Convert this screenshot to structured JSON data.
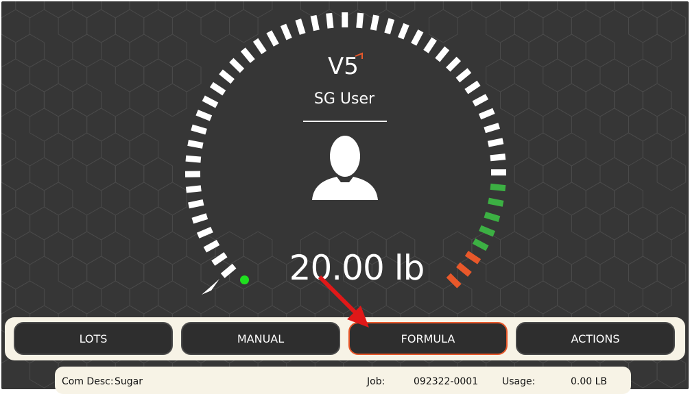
{
  "header": {
    "logo_text": "V5",
    "user_name": "SG User",
    "user_icon": "user-silhouette-icon"
  },
  "scale": {
    "weight_display": "20.00 lb",
    "status_dot_color": "#1fe01f",
    "segment_colors": {
      "normal": "#ffffff",
      "target": "#3cb043",
      "over": "#e8582a"
    }
  },
  "buttons": [
    {
      "label": "LOTS"
    },
    {
      "label": "MANUAL"
    },
    {
      "label": "FORMULA",
      "active": true
    },
    {
      "label": "ACTIONS"
    }
  ],
  "info": {
    "com_desc_label": "Com Desc:",
    "com_desc_value": "Sugar",
    "job_label": "Job:",
    "job_value": "092322-0001",
    "usage_label": "Usage:",
    "usage_value": "0.00 LB"
  },
  "accent_color": "#e8582a"
}
